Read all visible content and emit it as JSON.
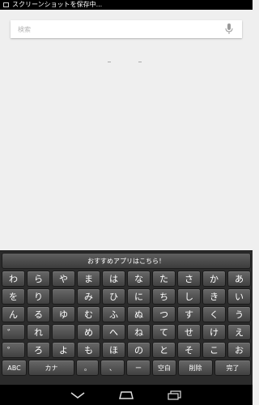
{
  "status_bar": {
    "notification_text": "スクリーンショットを保存中..."
  },
  "search": {
    "placeholder": "検索"
  },
  "keyboard": {
    "suggestion": "おすすめアプリはこちら！",
    "rows": [
      [
        "わ",
        "ら",
        "や",
        "ま",
        "は",
        "な",
        "た",
        "さ",
        "か",
        "あ"
      ],
      [
        "を",
        "り",
        "",
        "み",
        "ひ",
        "に",
        "ち",
        "し",
        "き",
        "い"
      ],
      [
        "ん",
        "る",
        "ゆ",
        "む",
        "ふ",
        "ぬ",
        "つ",
        "す",
        "く",
        "う"
      ],
      [
        "゛",
        "れ",
        "",
        "め",
        "へ",
        "ね",
        "て",
        "せ",
        "け",
        "え"
      ],
      [
        "゜",
        "ろ",
        "よ",
        "も",
        "ほ",
        "の",
        "と",
        "そ",
        "こ",
        "お"
      ]
    ],
    "bottom_row": [
      "ABC",
      "カナ",
      "。",
      "、",
      "ー",
      "空白",
      "削除",
      "完了"
    ]
  }
}
